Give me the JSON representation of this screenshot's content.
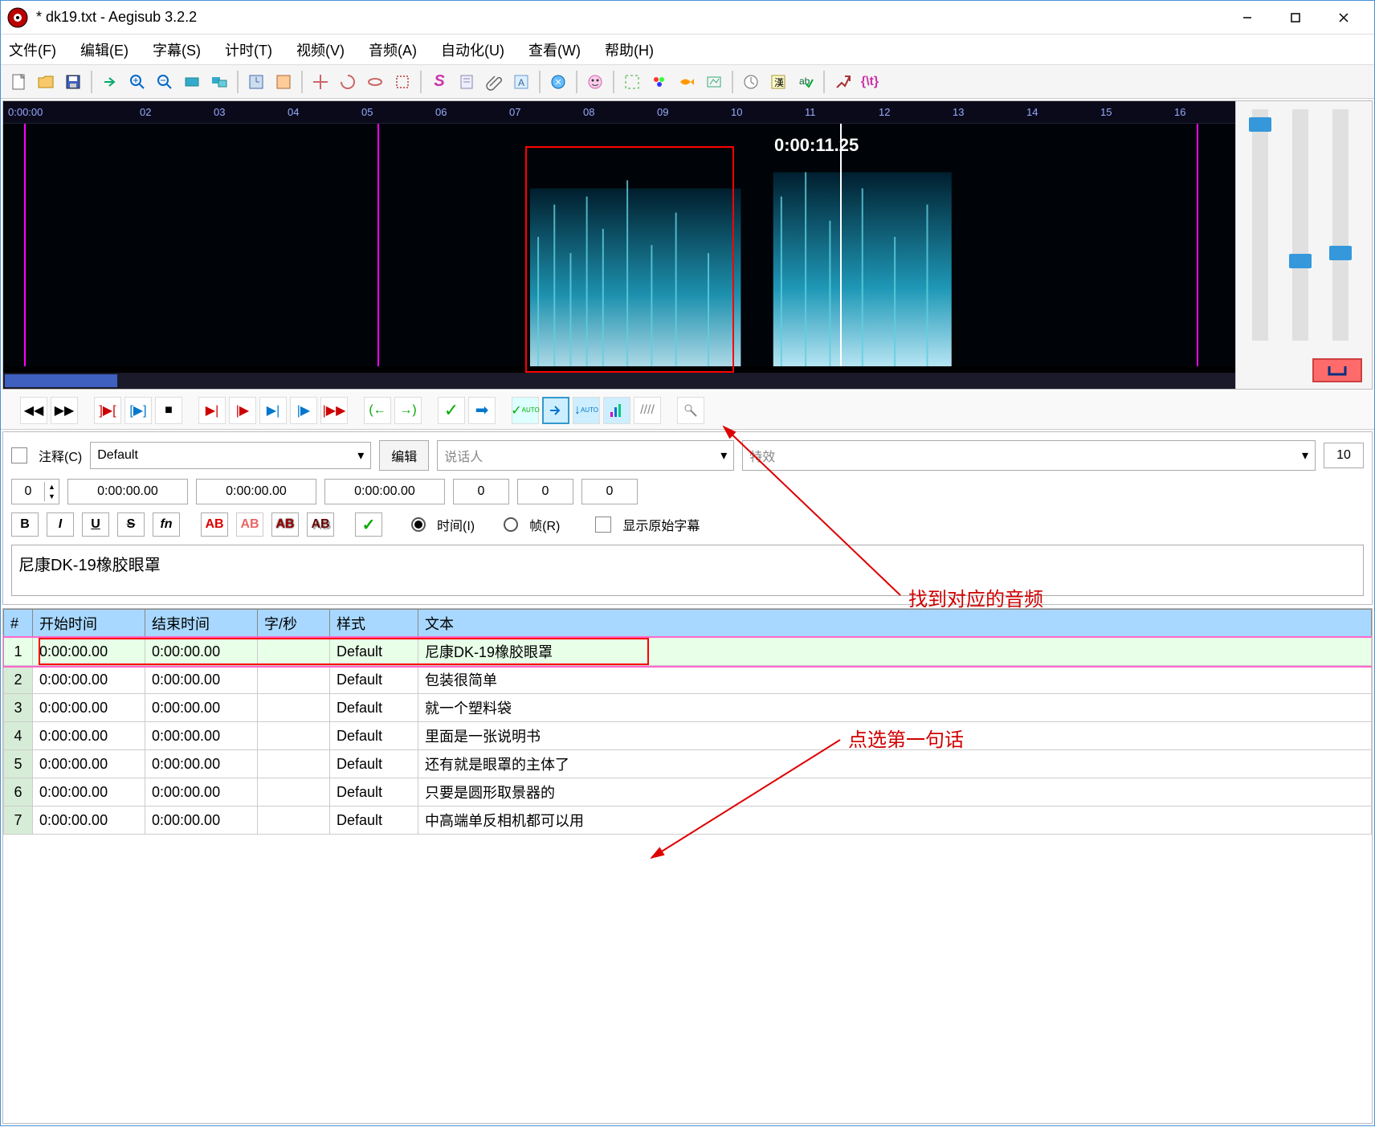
{
  "window": {
    "title": "* dk19.txt - Aegisub 3.2.2"
  },
  "menu": {
    "file": "文件(F)",
    "edit": "编辑(E)",
    "subs": "字幕(S)",
    "timing": "计时(T)",
    "video": "视频(V)",
    "audio": "音频(A)",
    "automation": "自动化(U)",
    "view": "查看(W)",
    "help": "帮助(H)"
  },
  "audio": {
    "ruler_start": "0:00:00",
    "ticks": [
      "02",
      "03",
      "04",
      "05",
      "06",
      "07",
      "08",
      "09",
      "10",
      "11",
      "12",
      "13",
      "14",
      "15",
      "16"
    ],
    "cursor_time": "0:00:11.25"
  },
  "edit": {
    "comment_label": "注释(C)",
    "style_selected": "Default",
    "edit_button": "编辑",
    "actor_placeholder": "说话人",
    "effect_placeholder": "特效",
    "margin_r": "10",
    "layer": "0",
    "start_time": "0:00:00.00",
    "end_time": "0:00:00.00",
    "duration": "0:00:00.00",
    "ml": "0",
    "mr": "0",
    "mv": "0",
    "time_label": "时间(I)",
    "frame_label": "帧(R)",
    "show_original_label": "显示原始字幕",
    "text": "尼康DK-19橡胶眼罩"
  },
  "grid": {
    "headers": {
      "num": "#",
      "start": "开始时间",
      "end": "结束时间",
      "cps": "字/秒",
      "style": "样式",
      "text": "文本"
    },
    "rows": [
      {
        "n": 1,
        "start": "0:00:00.00",
        "end": "0:00:00.00",
        "cps": "",
        "style": "Default",
        "text": "尼康DK-19橡胶眼罩",
        "selected": true
      },
      {
        "n": 2,
        "start": "0:00:00.00",
        "end": "0:00:00.00",
        "cps": "",
        "style": "Default",
        "text": "包装很简单"
      },
      {
        "n": 3,
        "start": "0:00:00.00",
        "end": "0:00:00.00",
        "cps": "",
        "style": "Default",
        "text": "就一个塑料袋"
      },
      {
        "n": 4,
        "start": "0:00:00.00",
        "end": "0:00:00.00",
        "cps": "",
        "style": "Default",
        "text": "里面是一张说明书"
      },
      {
        "n": 5,
        "start": "0:00:00.00",
        "end": "0:00:00.00",
        "cps": "",
        "style": "Default",
        "text": "还有就是眼罩的主体了"
      },
      {
        "n": 6,
        "start": "0:00:00.00",
        "end": "0:00:00.00",
        "cps": "",
        "style": "Default",
        "text": "只要是圆形取景器的"
      },
      {
        "n": 7,
        "start": "0:00:00.00",
        "end": "0:00:00.00",
        "cps": "",
        "style": "Default",
        "text": "中高端单反相机都可以用"
      }
    ]
  },
  "annotations": {
    "a1": "找到对应的音频",
    "a2": "点选第一句话"
  }
}
